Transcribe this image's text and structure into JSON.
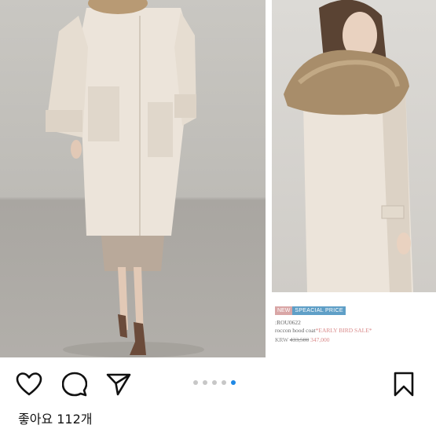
{
  "carousel": {
    "total_slides": 5,
    "active_slide": 5
  },
  "product_caption": {
    "badge_new": "NEW",
    "badge_special": "SPEACIAL PRICE",
    "code": ":ROU0622",
    "name": "roccon hood coat",
    "sale_tag": "*EARLY BIRD SALE*",
    "currency": "KRW",
    "old_price": "433,500",
    "new_price": "347,000"
  },
  "actions": {
    "like_icon": "heart-icon",
    "comment_icon": "comment-bubble-icon",
    "share_icon": "paper-plane-icon",
    "save_icon": "bookmark-icon"
  },
  "likes": {
    "label": "좋아요 112개"
  },
  "colors": {
    "active_dot": "#1e88e5",
    "inactive_dot": "#c7c7c7",
    "coat": "#ece4da"
  }
}
